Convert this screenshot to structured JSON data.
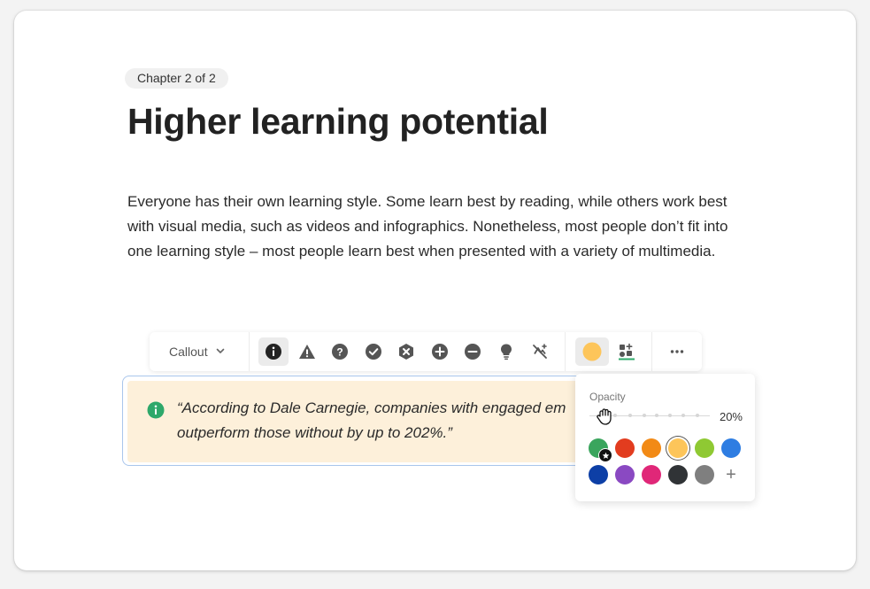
{
  "chapter": {
    "badge": "Chapter 2 of 2"
  },
  "page": {
    "title": "Higher learning potential",
    "paragraph": "Everyone has their own learning style. Some learn best by reading, while others work best with visual media, such as videos and infographics. Nonetheless, most people don’t fit into one learning style – most people learn best when presented with a variety of multimedia."
  },
  "toolbar": {
    "block_type_label": "Callout",
    "icons": [
      "info-icon",
      "warning-icon",
      "question-icon",
      "check-icon",
      "close-hex-icon",
      "plus-circle-icon",
      "minus-circle-icon",
      "lightbulb-icon",
      "no-icon-icon"
    ],
    "selected_icon": "info-icon",
    "color_button": "color-picker-icon",
    "style_button": "text-style-icon",
    "more_button": "more-icon"
  },
  "callout": {
    "text_line1": "“According to Dale Carnegie, companies with engaged em",
    "text_line2": "outperform those without by up to 202%.”",
    "background": "#fdf0da",
    "icon_color": "#2ea86a"
  },
  "color_popover": {
    "opacity_label": "Opacity",
    "opacity_value": "20%",
    "opacity_fraction": 0.2,
    "swatches": [
      {
        "name": "green",
        "color": "#3aa55d",
        "badge": "star-icon"
      },
      {
        "name": "red",
        "color": "#e23c1f"
      },
      {
        "name": "orange",
        "color": "#f28a16"
      },
      {
        "name": "yellow",
        "color": "#fdc55a",
        "selected": true
      },
      {
        "name": "lime",
        "color": "#8fc933"
      },
      {
        "name": "blue",
        "color": "#2e7de2"
      },
      {
        "name": "navy",
        "color": "#0d3fa6"
      },
      {
        "name": "purple",
        "color": "#8a49c2"
      },
      {
        "name": "pink",
        "color": "#e02778"
      },
      {
        "name": "black",
        "color": "#303336"
      },
      {
        "name": "gray",
        "color": "#7f7f7f"
      }
    ],
    "add_label": "+"
  }
}
